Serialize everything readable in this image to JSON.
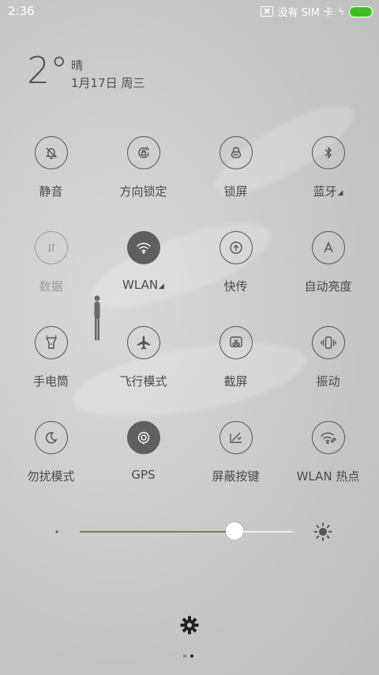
{
  "status_bar": {
    "time": "2:36",
    "sim_text": "没有 SIM 卡",
    "battery_color": "#39c21f"
  },
  "weather": {
    "temperature": "2°",
    "condition": "晴",
    "date": "1月17日 周三"
  },
  "toggles": [
    {
      "label": "静音",
      "icon": "mute-bell-icon",
      "state": "off"
    },
    {
      "label": "方向锁定",
      "icon": "rotation-lock-icon",
      "state": "off"
    },
    {
      "label": "锁屏",
      "icon": "lock-icon",
      "state": "off"
    },
    {
      "label": "蓝牙",
      "icon": "bluetooth-icon",
      "state": "off",
      "has_menu": true
    },
    {
      "label": "数据",
      "icon": "mobile-data-icon",
      "state": "disabled"
    },
    {
      "label": "WLAN",
      "icon": "wifi-icon",
      "state": "on",
      "has_menu": true
    },
    {
      "label": "快传",
      "icon": "quick-transfer-icon",
      "state": "off"
    },
    {
      "label": "自动亮度",
      "icon": "auto-brightness-icon",
      "state": "off"
    },
    {
      "label": "手电筒",
      "icon": "flashlight-icon",
      "state": "off"
    },
    {
      "label": "飞行模式",
      "icon": "airplane-icon",
      "state": "off"
    },
    {
      "label": "截屏",
      "icon": "screenshot-icon",
      "state": "off"
    },
    {
      "label": "振动",
      "icon": "vibrate-icon",
      "state": "off"
    },
    {
      "label": "勿扰模式",
      "icon": "moon-icon",
      "state": "off"
    },
    {
      "label": "GPS",
      "icon": "gps-icon",
      "state": "on"
    },
    {
      "label": "屏蔽按键",
      "icon": "block-keys-icon",
      "state": "off"
    },
    {
      "label": "WLAN 热点",
      "icon": "hotspot-icon",
      "state": "off"
    }
  ],
  "brightness": {
    "level_fraction": 0.73,
    "fill_color": "#7d7a55"
  },
  "pager": {
    "page_count": 2,
    "current_page": 2
  },
  "menu_marker": "◢"
}
